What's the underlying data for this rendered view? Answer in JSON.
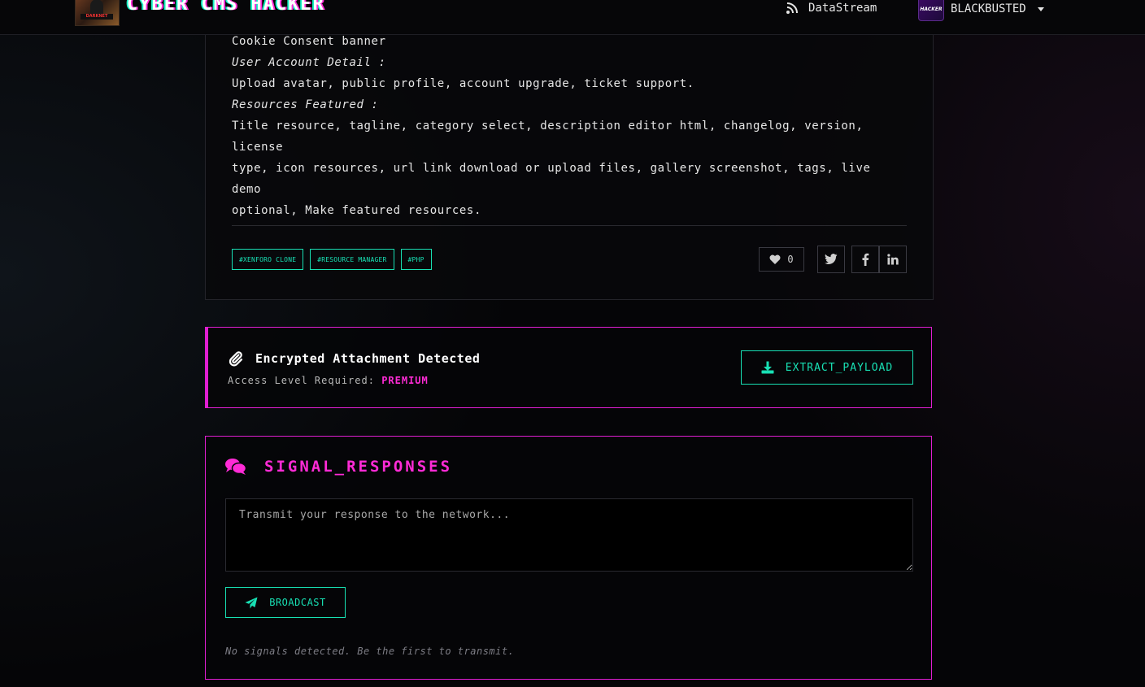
{
  "header": {
    "site_title": "CYBER CMS HACKER",
    "logo_text": "DARKNET",
    "nav_link": "DataStream",
    "avatar_text": "HACKER",
    "username": "BLACKBUSTED"
  },
  "post": {
    "lines": [
      {
        "text": "Cookie Consent banner",
        "italic": false
      },
      {
        "text": "User Account Detail :",
        "italic": true
      },
      {
        "text": "Upload avatar, public profile, account upgrade, ticket support.",
        "italic": false
      },
      {
        "text": "Resources Featured :",
        "italic": true
      },
      {
        "text": "Title resource, tagline, category select, description editor html, changelog, version, license",
        "italic": false
      },
      {
        "text": "type, icon resources, url link download or upload files, gallery screenshot, tags, live demo",
        "italic": false
      },
      {
        "text": "optional, Make featured resources.",
        "italic": false
      }
    ],
    "tags": [
      "#XENFORO CLONE",
      "#RESOURCE MANAGER",
      "#PHP"
    ],
    "like_count": "0",
    "share_icons": [
      "twitter-icon",
      "facebook-icon",
      "linkedin-icon"
    ]
  },
  "attachment": {
    "title": "Encrypted Attachment Detected",
    "access_label": "Access Level Required:",
    "access_value": "PREMIUM",
    "button_label": "EXTRACT_PAYLOAD"
  },
  "responses": {
    "title": "SIGNAL_RESPONSES",
    "placeholder": "Transmit your response to the network...",
    "button_label": "BROADCAST",
    "empty_text": "No signals detected. Be the first to transmit."
  },
  "colors": {
    "accent_cyan": "#18e0b4",
    "accent_magenta": "#e01ed2",
    "background": "#050507"
  }
}
